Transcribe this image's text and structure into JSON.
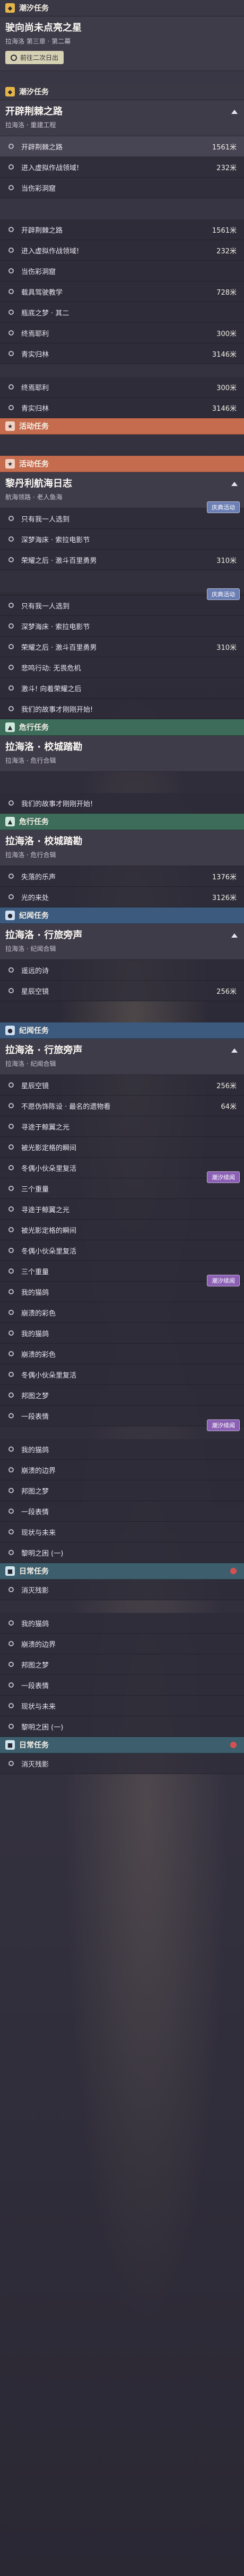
{
  "main1": {
    "header": "潮汐任务",
    "title": "驶向尚未点亮之星",
    "subtitle": "拉海洛 第三章 · 第二幕",
    "nav": "前往二次日出"
  },
  "explore1": {
    "header": "潮汐任务",
    "title": "开辟荆棘之路",
    "subtitle": "拉海洛 · 重建工程",
    "rows": [
      {
        "text": "开辟荆棘之路",
        "dist": "1561米"
      },
      {
        "text": "进入虚拟作战领域!",
        "dist": "232米"
      },
      {
        "text": "当伤彩洞窟",
        "dist": ""
      }
    ]
  },
  "explore2": {
    "rows": [
      {
        "text": "开辟荆棘之路",
        "dist": "1561米"
      },
      {
        "text": "进入虚拟作战领域!",
        "dist": "232米"
      },
      {
        "text": "当伤彩洞窟",
        "dist": ""
      },
      {
        "text": "载具驾驶教学",
        "dist": "728米"
      },
      {
        "text": "瓶底之梦 · 其二",
        "dist": ""
      },
      {
        "text": "终焉耶利",
        "dist": "300米"
      },
      {
        "text": "青实归林",
        "dist": "3146米"
      }
    ]
  },
  "event1": {
    "header": "活动任务",
    "rows": [
      {
        "text": "终焉耶利",
        "dist": "300米"
      },
      {
        "text": "青实归林",
        "dist": "3146米"
      }
    ]
  },
  "voyage": {
    "header": "活动任务",
    "title": "黎丹利航海日志",
    "subtitle": "航海领路 · 老人鱼海",
    "badge": "庆典活动",
    "rows": [
      {
        "text": "只有我一人选到",
        "dist": ""
      },
      {
        "text": "深梦海床 · 索拉电影节",
        "dist": ""
      },
      {
        "text": "荣耀之后 · 激斗百里勇男",
        "dist": "310米"
      }
    ]
  },
  "voyage2": {
    "badge": "庆典活动",
    "rows": [
      {
        "text": "只有我一人选到",
        "dist": ""
      },
      {
        "text": "深梦海床 · 索拉电影节",
        "dist": ""
      },
      {
        "text": "荣耀之后 · 激斗百里勇男",
        "dist": "310米"
      },
      {
        "text": "悲鸣行动: 无畏危机",
        "dist": ""
      },
      {
        "text": "激斗! 向着荣耀之后",
        "dist": ""
      },
      {
        "text": "我们的故事才刚刚开始!",
        "dist": ""
      }
    ]
  },
  "danger1": {
    "header": "危行任务",
    "title": "拉海洛 · 校城踏勘",
    "subtitle": "拉海洛 · 危行合辑",
    "rows": [
      {
        "text": "我们的故事才刚刚开始!",
        "dist": ""
      }
    ]
  },
  "danger2": {
    "header": "危行任务",
    "title": "拉海洛 · 校城踏勘",
    "subtitle": "拉海洛 · 危行合辑",
    "rows": [
      {
        "text": "失落的乐声",
        "dist": "1376米"
      },
      {
        "text": "光的来处",
        "dist": "3126米"
      }
    ]
  },
  "tales1": {
    "header": "纪闻任务",
    "title": "拉海洛 · 行旅旁声",
    "subtitle": "拉海洛 · 纪闻合辑",
    "rows": [
      {
        "text": "遥远的诗",
        "dist": ""
      },
      {
        "text": "星辰空镜",
        "dist": "256米"
      }
    ]
  },
  "tales2": {
    "header": "纪闻任务",
    "title": "拉海洛 · 行旅旁声",
    "subtitle": "拉海洛 · 纪闻合辑",
    "badge": "潮汐续闻",
    "rows": [
      {
        "text": "星辰空镜",
        "dist": "256米"
      },
      {
        "text": "不愿伪饰陈设 · 最名的遗物看",
        "dist": "64米"
      },
      {
        "text": "寻途于鲸翼之光",
        "dist": ""
      },
      {
        "text": "被光影定格的瞬间",
        "dist": ""
      },
      {
        "text": "冬偶小伙朵里复活",
        "dist": ""
      },
      {
        "text": "三个重量",
        "dist": ""
      }
    ]
  },
  "tales3": {
    "badge": "潮汐续闻",
    "rows": [
      {
        "text": "寻途于鲸翼之光",
        "dist": ""
      },
      {
        "text": "被光影定格的瞬间",
        "dist": ""
      },
      {
        "text": "冬偶小伙朵里复活",
        "dist": ""
      },
      {
        "text": "三个重量",
        "dist": ""
      },
      {
        "text": "我的猫鸽",
        "dist": ""
      },
      {
        "text": "崩溃的彩色",
        "dist": ""
      }
    ]
  },
  "tales4": {
    "badge": "潮汐续闻",
    "rows": [
      {
        "text": "我的猫鸽",
        "dist": ""
      },
      {
        "text": "崩溃的彩色",
        "dist": ""
      },
      {
        "text": "冬偶小伙朵里复活",
        "dist": ""
      },
      {
        "text": "邦图之梦",
        "dist": ""
      },
      {
        "text": "一段表情",
        "dist": ""
      }
    ]
  },
  "tales5": {
    "rows": [
      {
        "text": "我的猫鸽",
        "dist": ""
      },
      {
        "text": "崩溃的边界",
        "dist": ""
      },
      {
        "text": "邦图之梦",
        "dist": ""
      },
      {
        "text": "一段表情",
        "dist": ""
      },
      {
        "text": "现状与未来",
        "dist": ""
      },
      {
        "text": "黎明之困 (一)",
        "dist": ""
      }
    ]
  },
  "daily1": {
    "header": "日常任务",
    "rows": [
      {
        "text": "消灭残影",
        "dist": ""
      }
    ]
  },
  "tales6": {
    "rows": [
      {
        "text": "我的猫鸽",
        "dist": ""
      },
      {
        "text": "崩溃的边界",
        "dist": ""
      },
      {
        "text": "邦图之梦",
        "dist": ""
      },
      {
        "text": "一段表情",
        "dist": ""
      },
      {
        "text": "现状与未来",
        "dist": ""
      },
      {
        "text": "黎明之困 (一)",
        "dist": ""
      }
    ]
  },
  "daily2": {
    "header": "日常任务",
    "rows": [
      {
        "text": "消灭残影",
        "dist": ""
      }
    ]
  }
}
